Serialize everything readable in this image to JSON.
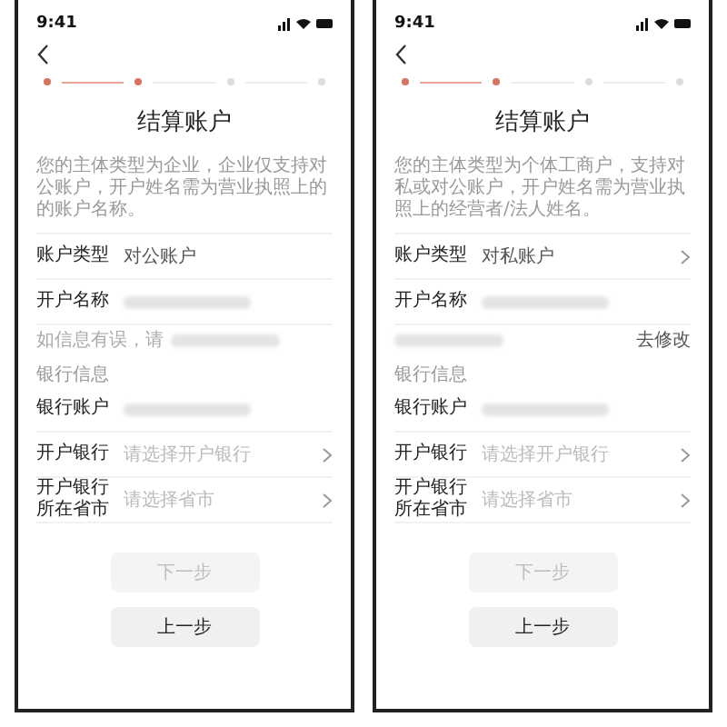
{
  "phones": [
    {
      "time": "9:41",
      "title": "结算账户",
      "steps": [
        {
          "done": true
        },
        {
          "done": true
        },
        {
          "done": false
        },
        {
          "done": false
        }
      ],
      "note": "您的主体类型为企业，企业仅支持对公账户，开户姓名需为营业执照上的的账户名称。",
      "rows": [
        {
          "kind": "field",
          "label": "账户类型",
          "value": "对公账户",
          "blurred": false,
          "chevron": false
        },
        {
          "kind": "field",
          "label": "开户名称",
          "blurred": true,
          "chevron": false
        },
        {
          "kind": "hint",
          "text": "如信息有误，请",
          "blurred": true
        },
        {
          "kind": "section",
          "label": "银行信息"
        },
        {
          "kind": "field",
          "label": "银行账户",
          "blurred": true,
          "chevron": false
        },
        {
          "kind": "field",
          "label": "开户银行",
          "placeholder": "请选择开户银行",
          "blurred": false,
          "chevron": true
        },
        {
          "kind": "field",
          "label": "开户银行所在省市",
          "placeholder": "请选择省市",
          "blurred": false,
          "chevron": true
        }
      ],
      "buttons": [
        {
          "label": "下一步",
          "disabled": true
        },
        {
          "label": "上一步",
          "disabled": false
        }
      ]
    },
    {
      "time": "9:41",
      "title": "结算账户",
      "steps": [
        {
          "done": true
        },
        {
          "done": true
        },
        {
          "done": false
        },
        {
          "done": false
        }
      ],
      "note": "您的主体类型为个体工商户，支持对私或对公账户，开户姓名需为营业执照上的经营者/法人姓名。",
      "rows": [
        {
          "kind": "field",
          "label": "账户类型",
          "value": "对私账户",
          "blurred": false,
          "chevron": true
        },
        {
          "kind": "field",
          "label": "开户名称",
          "blurred": true,
          "chevron": false
        },
        {
          "kind": "hint",
          "link": "去修改",
          "blurred": true
        },
        {
          "kind": "section",
          "label": "银行信息"
        },
        {
          "kind": "field",
          "label": "银行账户",
          "blurred": true,
          "chevron": false
        },
        {
          "kind": "field",
          "label": "开户银行",
          "placeholder": "请选择开户银行",
          "blurred": false,
          "chevron": true
        },
        {
          "kind": "field",
          "label": "开户银行所在省市",
          "placeholder": "请选择省市",
          "blurred": false,
          "chevron": true
        }
      ],
      "buttons": [
        {
          "label": "下一步",
          "disabled": true
        },
        {
          "label": "上一步",
          "disabled": false
        }
      ]
    }
  ]
}
